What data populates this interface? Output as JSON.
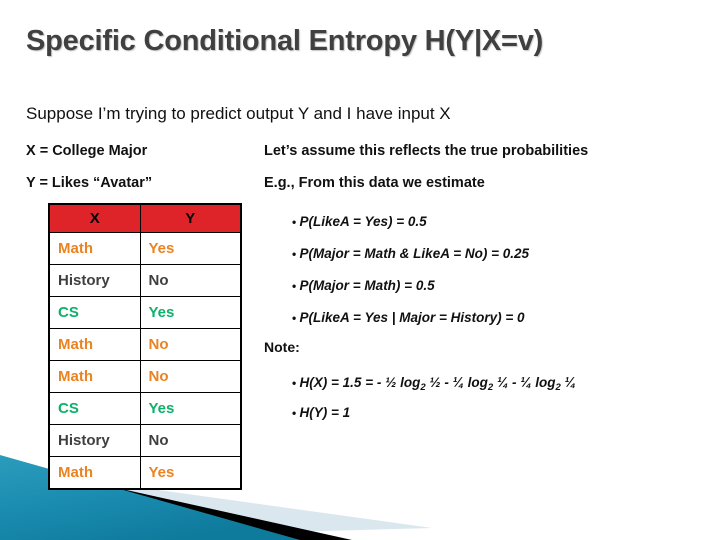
{
  "slide": {
    "title": "Specific Conditional Entropy H(Y|X=v)",
    "title_color": "#404040",
    "background": "#ffffff",
    "lead": "Suppose I’m trying to predict output Y and I have input X",
    "definitions": [
      "X = College Major",
      "Y = Likes “Avatar”"
    ],
    "assumptions": [
      "Let’s assume this reflects the true probabilities",
      "E.g., From this data we estimate"
    ]
  },
  "table": {
    "header_color": "#de2429",
    "header_text_color": "#000000",
    "border_color": "#000000",
    "columns": [
      "X",
      "Y"
    ],
    "value_colors": {
      "Math": "#eb8322",
      "History": "#3f3f3f",
      "CS": "#0fb06a"
    },
    "rows": [
      {
        "x": "Math",
        "y": "Yes",
        "x_class": "v-math",
        "y_class": "v-math"
      },
      {
        "x": "History",
        "y": "No",
        "x_class": "v-history",
        "y_class": "v-history"
      },
      {
        "x": "CS",
        "y": "Yes",
        "x_class": "v-cs",
        "y_class": "v-cs"
      },
      {
        "x": "Math",
        "y": "No",
        "x_class": "v-math",
        "y_class": "v-math"
      },
      {
        "x": "Math",
        "y": "No",
        "x_class": "v-math",
        "y_class": "v-math"
      },
      {
        "x": "CS",
        "y": "Yes",
        "x_class": "v-cs",
        "y_class": "v-cs"
      },
      {
        "x": "History",
        "y": "No",
        "x_class": "v-history",
        "y_class": "v-history"
      },
      {
        "x": "Math",
        "y": "Yes",
        "x_class": "v-math",
        "y_class": "v-math"
      }
    ]
  },
  "probabilities": [
    "P(LikeA = Yes) = 0.5",
    "P(Major = Math & LikeA = No) = 0.25",
    "P(Major = Math) = 0.5",
    "P(LikeA = Yes | Major = History) = 0"
  ],
  "note": {
    "label": "Note:",
    "entries": [
      {
        "parts": [
          {
            "text": "H(X) = 1.5 = - ½ log"
          },
          {
            "text": "2",
            "sub": true
          },
          {
            "text": " ½ - ¼ log"
          },
          {
            "text": "2",
            "sub": true
          },
          {
            "text": " ¼ - ¼ log"
          },
          {
            "text": "2",
            "sub": true
          },
          {
            "text": " ¼"
          }
        ]
      },
      {
        "parts": [
          {
            "text": "H(Y) = 1"
          }
        ]
      }
    ]
  },
  "decoration": {
    "teal": "#1a8cb0",
    "teal_dark": "#0f7596",
    "pale_blue": "#dbe7ee",
    "black": "#000000"
  }
}
